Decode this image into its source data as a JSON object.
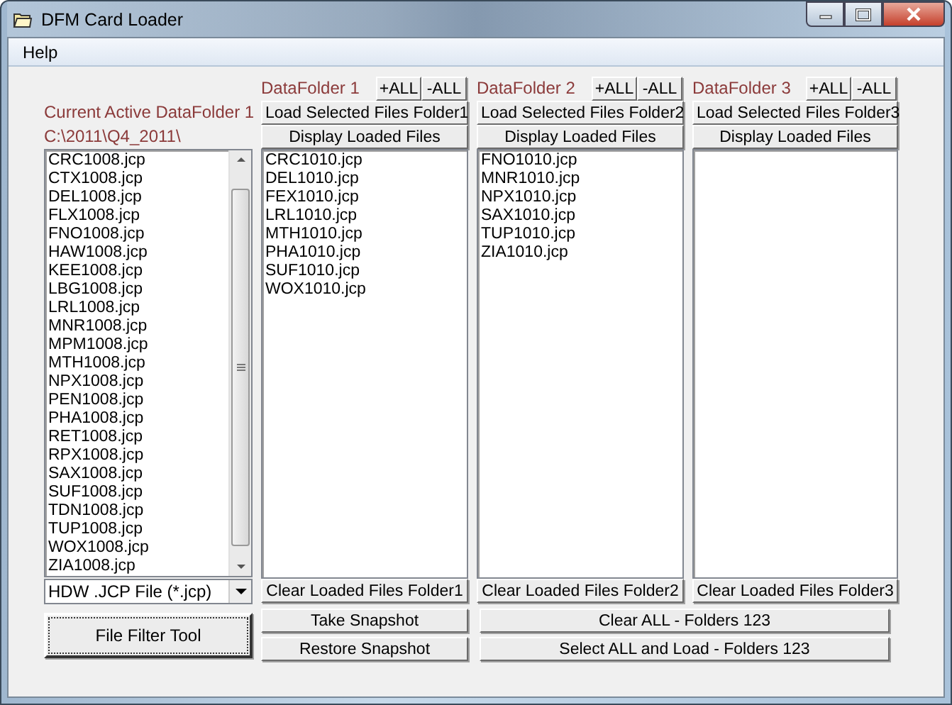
{
  "window": {
    "title": "DFM Card Loader"
  },
  "menu": [
    "Help"
  ],
  "active_folder": {
    "label": "Current Active DataFolder 1",
    "path": "C:\\2011\\Q4_2011\\"
  },
  "file_list": [
    "CRC1008.jcp",
    "CTX1008.jcp",
    "DEL1008.jcp",
    "FLX1008.jcp",
    "FNO1008.jcp",
    "HAW1008.jcp",
    "KEE1008.jcp",
    "LBG1008.jcp",
    "LRL1008.jcp",
    "MNR1008.jcp",
    "MPM1008.jcp",
    "MTH1008.jcp",
    "NPX1008.jcp",
    "PEN1008.jcp",
    "PHA1008.jcp",
    "RET1008.jcp",
    "RPX1008.jcp",
    "SAX1008.jcp",
    "SUF1008.jcp",
    "TDN1008.jcp",
    "TUP1008.jcp",
    "WOX1008.jcp",
    "ZIA1008.jcp"
  ],
  "file_filter": {
    "value": "HDW .JCP File (*.jcp)"
  },
  "file_filter_button": "File Filter Tool",
  "folders": [
    {
      "label": "DataFolder 1",
      "add_all": "+ALL",
      "remove_all": "-ALL",
      "load_button": "Load Selected Files Folder1",
      "display_button": "Display Loaded Files",
      "files": [
        "CRC1010.jcp",
        "DEL1010.jcp",
        "FEX1010.jcp",
        "LRL1010.jcp",
        "MTH1010.jcp",
        "PHA1010.jcp",
        "SUF1010.jcp",
        "WOX1010.jcp"
      ],
      "clear_button": "Clear Loaded Files Folder1"
    },
    {
      "label": "DataFolder 2",
      "add_all": "+ALL",
      "remove_all": "-ALL",
      "load_button": "Load Selected Files Folder2",
      "display_button": "Display Loaded Files",
      "files": [
        "FNO1010.jcp",
        "MNR1010.jcp",
        "NPX1010.jcp",
        "SAX1010.jcp",
        "TUP1010.jcp",
        "ZIA1010.jcp"
      ],
      "clear_button": "Clear Loaded Files Folder2"
    },
    {
      "label": "DataFolder 3",
      "add_all": "+ALL",
      "remove_all": "-ALL",
      "load_button": "Load Selected Files Folder3",
      "display_button": "Display Loaded Files",
      "clear_button": "Clear Loaded Files Folder3"
    }
  ],
  "snapshot_buttons": [
    "Take Snapshot",
    "Restore Snapshot"
  ],
  "all_buttons": [
    "Clear ALL - Folders 123",
    "Select ALL and Load - Folders 123"
  ]
}
